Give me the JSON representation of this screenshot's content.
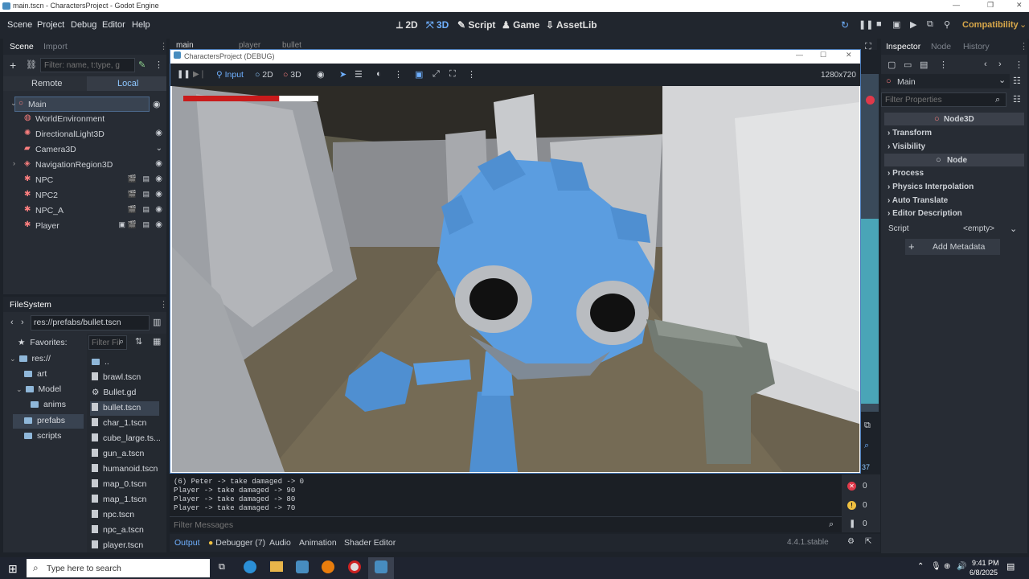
{
  "window_title": "main.tscn - CharactersProject - Godot Engine",
  "menu": [
    "Scene",
    "Project",
    "Debug",
    "Editor",
    "Help"
  ],
  "workspaces": [
    {
      "label": "2D",
      "icon": "2d-icon"
    },
    {
      "label": "3D",
      "icon": "3d-icon"
    },
    {
      "label": "Script",
      "icon": "script-icon"
    },
    {
      "label": "Game",
      "icon": "game-icon"
    },
    {
      "label": "AssetLib",
      "icon": "assetlib-icon"
    }
  ],
  "renderer": "Compatibility",
  "scene_dock": {
    "tabs": [
      "Scene",
      "Import"
    ],
    "filter_placeholder": "Filter: name, t:type, g",
    "remote_label": "Remote",
    "local_label": "Local",
    "nodes": [
      {
        "name": "Main",
        "icon": "node3d-icon",
        "color": "#fc7f7f"
      },
      {
        "name": "WorldEnvironment",
        "icon": "world-environment-icon",
        "color": "#fc7f7f"
      },
      {
        "name": "DirectionalLight3D",
        "icon": "light-icon",
        "color": "#fc7f7f"
      },
      {
        "name": "Camera3D",
        "icon": "camera-icon",
        "color": "#fc7f7f"
      },
      {
        "name": "NavigationRegion3D",
        "icon": "navigation-icon",
        "color": "#fc7f7f"
      },
      {
        "name": "NPC",
        "icon": "character-icon",
        "color": "#fc7f7f"
      },
      {
        "name": "NPC2",
        "icon": "character-icon",
        "color": "#fc7f7f"
      },
      {
        "name": "NPC_A",
        "icon": "character-icon",
        "color": "#fc7f7f"
      },
      {
        "name": "Player",
        "icon": "character-icon",
        "color": "#fc7f7f"
      }
    ]
  },
  "filesystem": {
    "title": "FileSystem",
    "path": "res://prefabs/bullet.tscn",
    "favorites_label": "Favorites:",
    "tree": [
      "res://",
      "art",
      "Model",
      "anims",
      "prefabs",
      "scripts"
    ],
    "filter_placeholder": "Filter Fil",
    "files": [
      "..",
      "brawl.tscn",
      "Bullet.gd",
      "bullet.tscn",
      "char_1.tscn",
      "cube_large.ts...",
      "gun_a.tscn",
      "humanoid.tscn",
      "map_0.tscn",
      "map_1.tscn",
      "npc.tscn",
      "npc_a.tscn",
      "player.tscn"
    ],
    "selected_file": "bullet.tscn"
  },
  "editor_tabs": [
    "main",
    "player",
    "bullet"
  ],
  "game_window": {
    "title": "CharactersProject (DEBUG)",
    "toolbar": {
      "input": "Input",
      "mode_2d": "2D",
      "mode_3d": "3D"
    },
    "resolution": "1280x720",
    "health_fraction": 0.71
  },
  "output": {
    "lines": [
      "(6) Peter -> take damaged -> 0",
      "Player -> take damaged -> 90",
      "Player -> take damaged -> 80",
      "Player -> take damaged -> 70"
    ],
    "filter_placeholder": "Filter Messages",
    "error_count": "0",
    "warning_count": "0",
    "message_count": "0",
    "side_number": "37"
  },
  "bottom_tabs": [
    "Output",
    "Debugger (7)",
    "Audio",
    "Animation",
    "Shader Editor"
  ],
  "version": "4.4.1.stable",
  "inspector": {
    "tabs": [
      "Inspector",
      "Node",
      "History"
    ],
    "node_name": "Main",
    "filter_placeholder": "Filter Properties",
    "class_header": "Node3D",
    "sections1": [
      "Transform",
      "Visibility"
    ],
    "node_header": "Node",
    "sections2": [
      "Process",
      "Physics Interpolation",
      "Auto Translate",
      "Editor Description"
    ],
    "script_label": "Script",
    "script_value": "<empty>",
    "add_metadata": "Add Metadata"
  },
  "taskbar": {
    "search_placeholder": "Type here to search",
    "time": "9:41 PM",
    "date": "6/8/2025"
  }
}
